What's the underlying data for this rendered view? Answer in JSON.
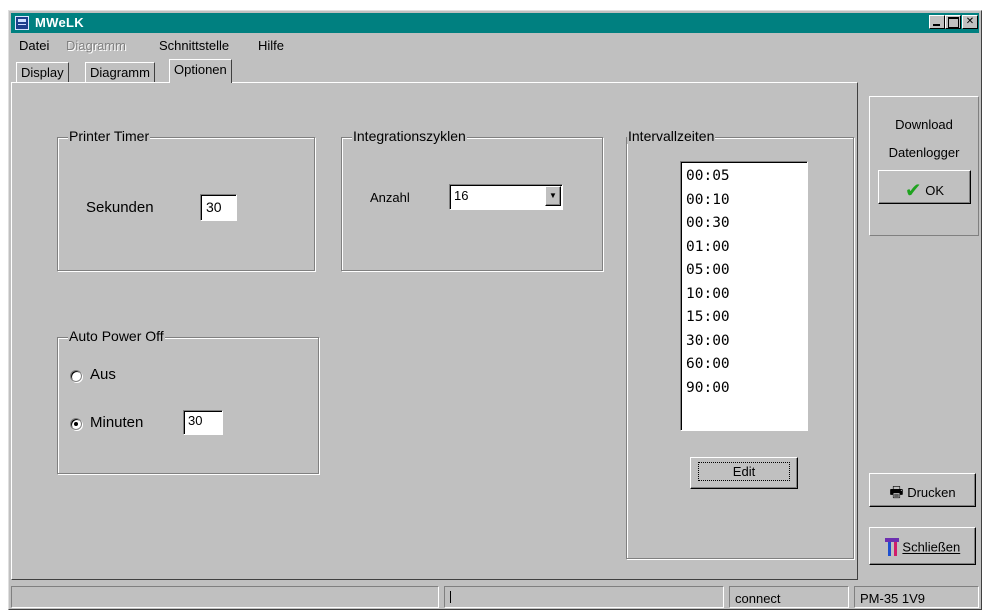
{
  "window": {
    "title": "MWeLK"
  },
  "menu": {
    "items": [
      {
        "label": "Datei",
        "disabled": false
      },
      {
        "label": "Diagramm",
        "disabled": true
      },
      {
        "label": "Schnittstelle",
        "disabled": false
      },
      {
        "label": "Hilfe",
        "disabled": false
      }
    ]
  },
  "tabs": [
    {
      "label": "Display",
      "active": false
    },
    {
      "label": "Diagramm",
      "active": false
    },
    {
      "label": "Optionen",
      "active": true
    }
  ],
  "printer_timer": {
    "title": "Printer Timer",
    "label": "Sekunden",
    "value": "30"
  },
  "integration": {
    "title": "Integrationszyklen",
    "label": "Anzahl",
    "value": "16"
  },
  "auto_power_off": {
    "title": "Auto Power Off",
    "option_off": "Aus",
    "option_minutes": "Minuten",
    "selected": "Minuten",
    "minutes_value": "30"
  },
  "intervals": {
    "title": "Intervallzeiten",
    "items": [
      "00:05",
      "00:10",
      "00:30",
      "01:00",
      "05:00",
      "10:00",
      "15:00",
      "30:00",
      "60:00",
      "90:00"
    ],
    "edit_label": "Edit"
  },
  "download": {
    "line1": "Download",
    "line2": "Datenlogger",
    "ok_label": "OK"
  },
  "buttons": {
    "print_label": "Drucken",
    "close_label": "Schließen"
  },
  "status": {
    "pane1": "",
    "pane2": "",
    "pane3": "connect",
    "pane4": "PM-35  1V9"
  },
  "colors": {
    "titlebar": "#008080",
    "face": "#c0c0c0",
    "ok_check": "#1fa31f"
  }
}
